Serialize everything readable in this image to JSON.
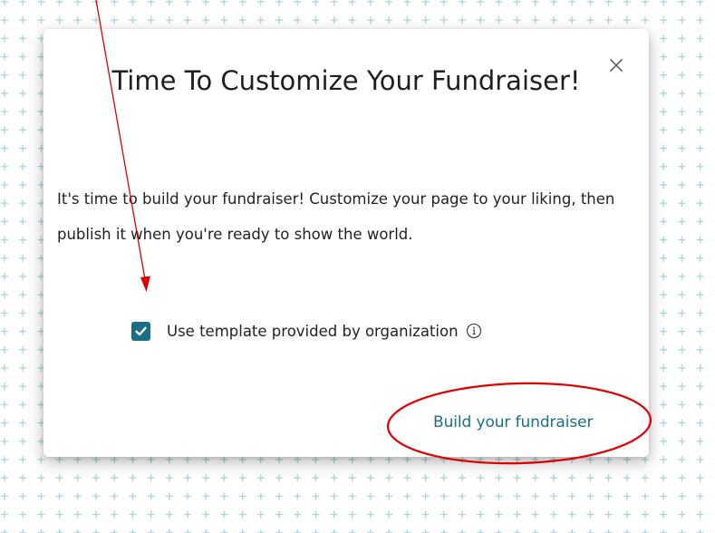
{
  "dialog": {
    "title": "Time To Customize Your Fundraiser!",
    "body": "It's time to build your fundraiser! Customize your page to your liking, then publish it when you're ready to show the world.",
    "close_icon": "close-icon",
    "template_checkbox": {
      "label": "Use template provided by organization",
      "checked": true,
      "info_icon": "info-icon"
    },
    "build_button_label": "Build your fundraiser"
  },
  "colors": {
    "accent": "#1a6f86",
    "background_plus": "#a9d3d6",
    "annotation": "#e00000"
  }
}
